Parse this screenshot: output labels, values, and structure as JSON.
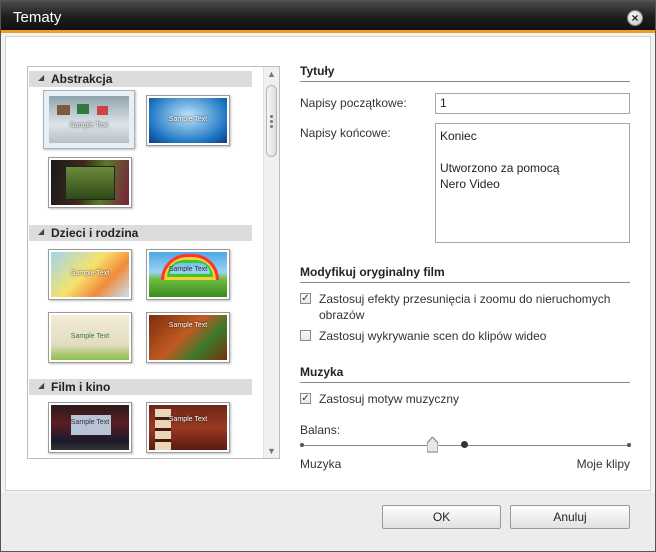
{
  "window": {
    "title": "Tematy"
  },
  "themes": {
    "categories": [
      {
        "label": "Abstrakcja"
      },
      {
        "label": "Dzieci i rodzina"
      },
      {
        "label": "Film i kino"
      }
    ],
    "sample_text": "Sample Text"
  },
  "titles": {
    "section": "Tytuły",
    "opening_label": "Napisy początkowe:",
    "opening_value": "1",
    "closing_label": "Napisy końcowe:",
    "closing_value": "Koniec\n\nUtworzono za pomocą\nNero Video"
  },
  "modify": {
    "section": "Modyfikuj oryginalny film",
    "pan_zoom_label": "Zastosuj efekty przesunięcia i zoomu do nieruchomych obrazów",
    "pan_zoom_checked": true,
    "scene_detect_label": "Zastosuj wykrywanie scen do klipów wideo",
    "scene_detect_checked": false
  },
  "music": {
    "section": "Muzyka",
    "apply_label": "Zastosuj motyw muzyczny",
    "apply_checked": true,
    "balance_label": "Balans:",
    "left_label": "Muzyka",
    "right_label": "Moje klipy",
    "balance_value": 0.4
  },
  "buttons": {
    "ok": "OK",
    "cancel": "Anuluj"
  },
  "colors": {
    "accent": "#f29a2e"
  }
}
